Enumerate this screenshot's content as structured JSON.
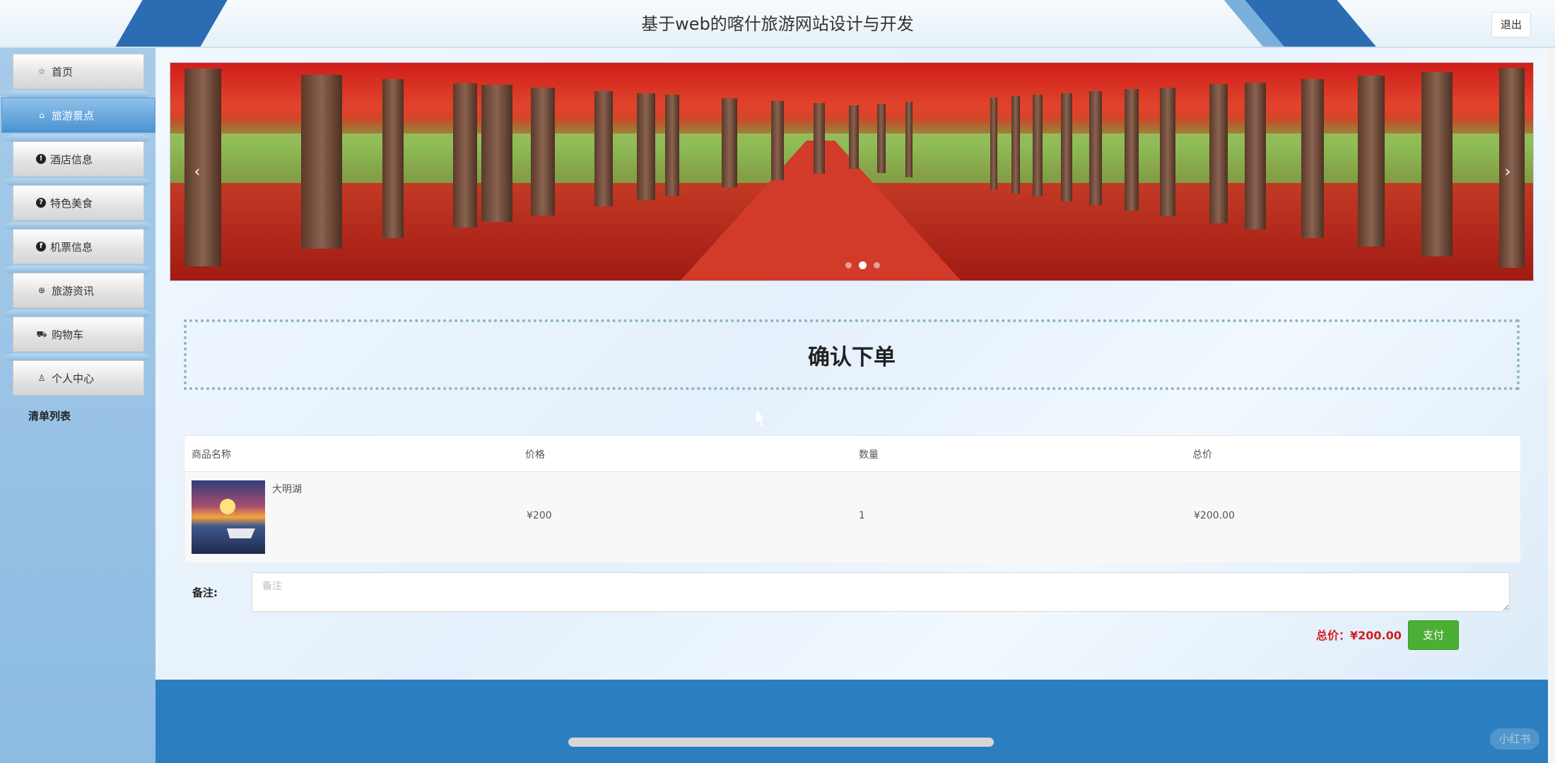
{
  "header": {
    "title": "基于web的喀什旅游网站设计与开发",
    "logout_label": "退出"
  },
  "sidebar": {
    "items": [
      {
        "label": "首页",
        "icon": "star-icon",
        "glyph": "☆"
      },
      {
        "label": "旅游景点",
        "icon": "bag-icon",
        "glyph": "⌂"
      },
      {
        "label": "酒店信息",
        "icon": "exclamation-icon",
        "glyph": "!"
      },
      {
        "label": "特色美食",
        "icon": "question-icon",
        "glyph": "?"
      },
      {
        "label": "机票信息",
        "icon": "facebook-icon",
        "glyph": "f"
      },
      {
        "label": "旅游资讯",
        "icon": "globe-icon",
        "glyph": "⊕"
      },
      {
        "label": "购物车",
        "icon": "cart-icon",
        "glyph": "⛟"
      },
      {
        "label": "个人中心",
        "icon": "user-icon",
        "glyph": "♙"
      }
    ],
    "active_index": 1
  },
  "banner": {
    "prev_glyph": "‹",
    "next_glyph": "›",
    "dots": 3,
    "active_dot": 1
  },
  "main": {
    "heading": "确认下单",
    "list_label": "清单列表",
    "table": {
      "headers": [
        "商品名称",
        "价格",
        "数量",
        "总价"
      ],
      "rows": [
        {
          "name": "大明湖",
          "price": "¥200",
          "quantity": "1",
          "total": "¥200.00"
        }
      ]
    },
    "note": {
      "label": "备注:",
      "placeholder": "备注",
      "value": ""
    },
    "total": {
      "label": "总价：¥200.00"
    },
    "pay_label": "支付"
  },
  "watermark": "小红书",
  "colors": {
    "accent": "#2b7fc0",
    "active_nav": "#4a93d1",
    "pay_green": "#4caf35",
    "total_red": "#d11f1f"
  }
}
